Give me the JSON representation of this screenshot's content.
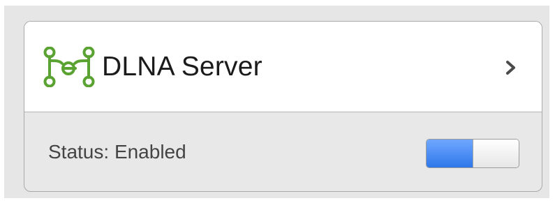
{
  "service": {
    "title": "DLNA Server",
    "icon": "dlna-network-icon",
    "status_text": "Status: Enabled",
    "enabled": true
  },
  "colors": {
    "accent": "#2f78ea",
    "icon_green": "#5aa332"
  }
}
